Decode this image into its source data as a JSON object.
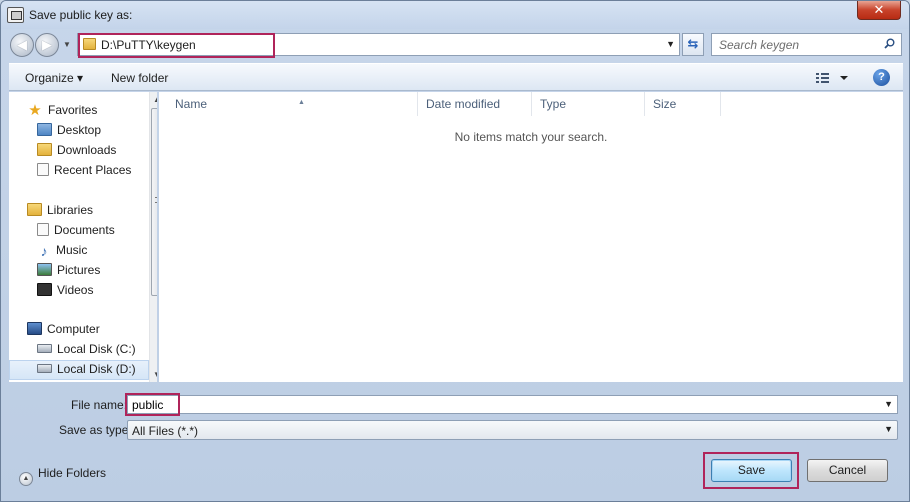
{
  "window": {
    "title": "Save public key as:",
    "close_label": "✕"
  },
  "address_bar": {
    "path": "D:\\PuTTY\\keygen",
    "refresh_icon": "refresh-icon"
  },
  "search": {
    "placeholder": "Search keygen"
  },
  "toolbar": {
    "organize_label": "Organize ▾",
    "new_folder_label": "New folder",
    "help_label": "?"
  },
  "nav_pane": {
    "favorites": {
      "label": "Favorites",
      "items": [
        "Desktop",
        "Downloads",
        "Recent Places"
      ]
    },
    "libraries": {
      "label": "Libraries",
      "items": [
        "Documents",
        "Music",
        "Pictures",
        "Videos"
      ]
    },
    "computer": {
      "label": "Computer",
      "items": [
        "Local Disk (C:)",
        "Local Disk (D:)"
      ]
    },
    "selected": "Local Disk (D:)"
  },
  "file_list": {
    "columns": [
      "Name",
      "Date modified",
      "Type",
      "Size"
    ],
    "empty_message": "No items match your search."
  },
  "fields": {
    "file_name_label": "File name:",
    "file_name_value": "public",
    "save_as_type_label": "Save as type:",
    "save_as_type_value": "All Files (*.*)"
  },
  "footer": {
    "hide_folders_label": "Hide Folders",
    "save_label": "Save",
    "cancel_label": "Cancel"
  },
  "colors": {
    "highlight": "#b0245a",
    "accent": "#3c7fb1"
  }
}
